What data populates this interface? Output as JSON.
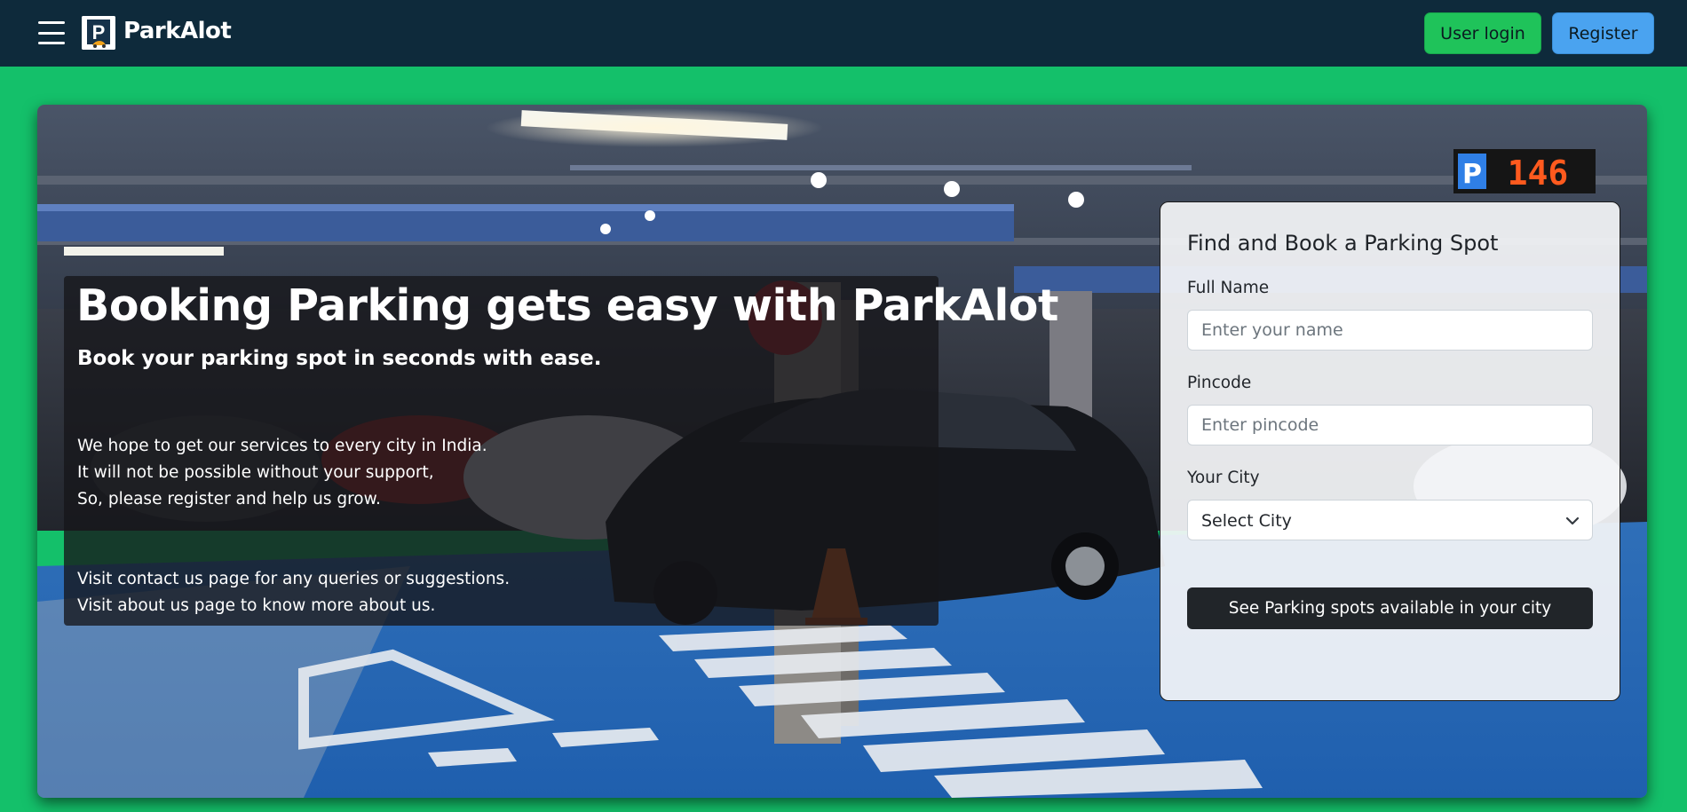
{
  "navbar": {
    "brand": "ParkAlot",
    "logo_letter": "P",
    "login_label": "User login",
    "register_label": "Register",
    "colors": {
      "background": "#0e2a3b",
      "login": "#1fc35a",
      "register": "#4aa3f0"
    }
  },
  "hero": {
    "title": "Booking Parking gets easy with ParkAlot",
    "subtitle": "Book your parking spot in seconds with ease.",
    "paragraph1": [
      "We hope to get our services to every city in India.",
      "It will not be possible without your support,",
      "So, please register and help us grow."
    ],
    "paragraph2": [
      "Visit contact us page for any queries or suggestions.",
      "Visit about us page to know more about us."
    ],
    "sign_text": "146"
  },
  "form": {
    "title": "Find and Book a Parking Spot",
    "name_label": "Full Name",
    "name_placeholder": "Enter your name",
    "pincode_label": "Pincode",
    "pincode_placeholder": "Enter pincode",
    "city_label": "Your City",
    "city_selected": "Select City",
    "submit_label": "See Parking spots available in your city"
  },
  "page": {
    "background": "#14c06a"
  }
}
